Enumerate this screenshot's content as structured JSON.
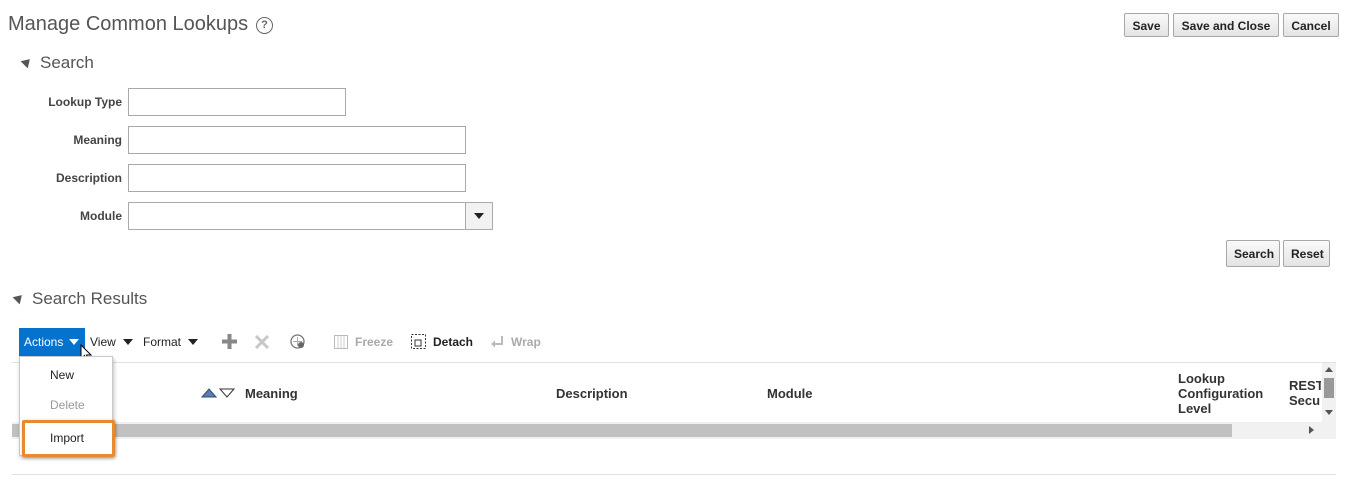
{
  "page": {
    "title": "Manage Common Lookups",
    "help_glyph": "?"
  },
  "header_buttons": {
    "save": "Save",
    "save_and_close": "Save and Close",
    "cancel": "Cancel"
  },
  "search": {
    "heading": "Search",
    "fields": {
      "lookup_type_label": "Lookup Type",
      "lookup_type_value": "",
      "meaning_label": "Meaning",
      "meaning_value": "",
      "description_label": "Description",
      "description_value": "",
      "module_label": "Module",
      "module_value": ""
    },
    "search_button": "Search",
    "reset_button": "Reset"
  },
  "results": {
    "heading": "Search Results",
    "toolbar": {
      "actions": "Actions",
      "view": "View",
      "format": "Format",
      "freeze": "Freeze",
      "detach": "Detach",
      "wrap": "Wrap"
    },
    "columns": {
      "meaning": "Meaning",
      "description": "Description",
      "module": "Module",
      "lookup_config_1": "Lookup",
      "lookup_config_2": "Configuration",
      "lookup_config_3": "Level",
      "rest_1": "REST",
      "rest_2": "Secu"
    },
    "actions_menu": {
      "new": "New",
      "delete": "Delete",
      "import": "Import"
    }
  },
  "colors": {
    "actions_blue": "#0572ce",
    "highlight_orange": "#e88a2e"
  }
}
